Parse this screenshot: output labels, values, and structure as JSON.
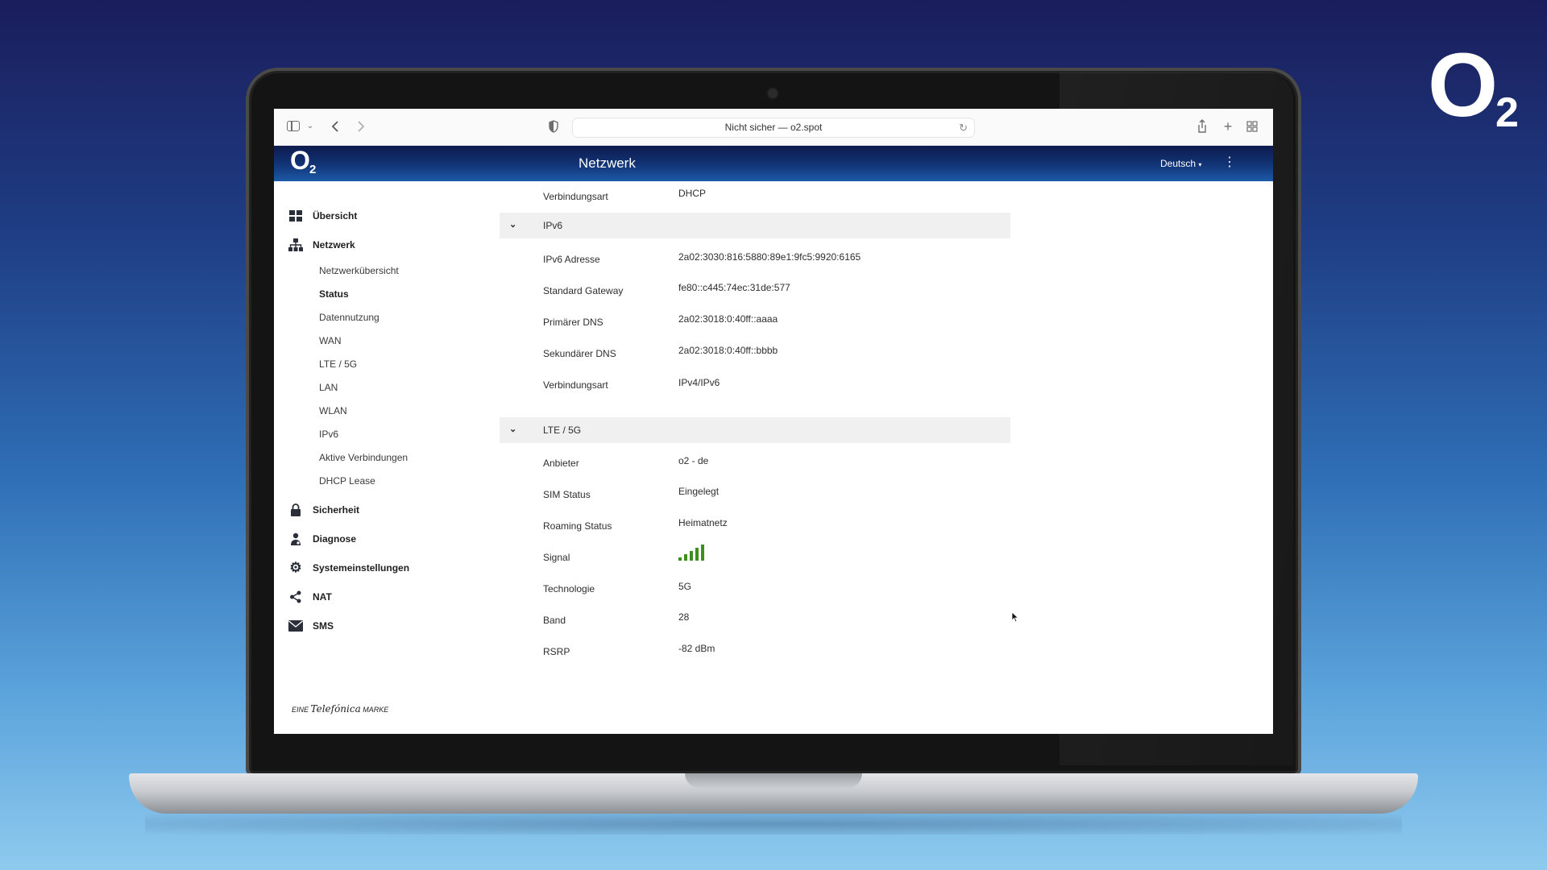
{
  "brand": {
    "letter": "O",
    "subscript": "2"
  },
  "browser": {
    "url_text": "Nicht sicher — o2.spot",
    "icons": [
      "sidebar-icon",
      "chevron-down-icon",
      "back-icon",
      "forward-icon",
      "shield-icon",
      "reload-icon",
      "share-icon",
      "plus-icon",
      "tab-overview-icon"
    ]
  },
  "header": {
    "logo_letter": "O",
    "logo_sub": "2",
    "title": "Netzwerk",
    "language": "Deutsch"
  },
  "sidebar": {
    "items": [
      {
        "label": "Übersicht",
        "icon": "dashboard-icon"
      },
      {
        "label": "Netzwerk",
        "icon": "network-icon"
      },
      {
        "label": "Sicherheit",
        "icon": "lock-icon"
      },
      {
        "label": "Diagnose",
        "icon": "diagnose-icon"
      },
      {
        "label": "Systemeinstellungen",
        "icon": "gear-icon"
      },
      {
        "label": "NAT",
        "icon": "share-icon"
      },
      {
        "label": "SMS",
        "icon": "envelope-icon"
      }
    ],
    "sub_items": [
      "Netzwerkübersicht",
      "Status",
      "Datennutzung",
      "WAN",
      "LTE / 5G",
      "LAN",
      "WLAN",
      "IPv6",
      "Aktive Verbindungen",
      "DHCP Lease"
    ],
    "active_sub": "Status",
    "footer": {
      "pre": "EINE",
      "brand": "Telefónica",
      "post": "MARKE"
    }
  },
  "content": {
    "top_row": {
      "label": "Verbindungsart",
      "value": "DHCP"
    },
    "ipv6": {
      "title": "IPv6",
      "rows": [
        {
          "label": "IPv6 Adresse",
          "value": "2a02:3030:816:5880:89e1:9fc5:9920:6165"
        },
        {
          "label": "Standard Gateway",
          "value": "fe80::c445:74ec:31de:577"
        },
        {
          "label": "Primärer DNS",
          "value": "2a02:3018:0:40ff::aaaa"
        },
        {
          "label": "Sekundärer DNS",
          "value": "2a02:3018:0:40ff::bbbb"
        },
        {
          "label": "Verbindungsart",
          "value": "IPv4/IPv6"
        }
      ]
    },
    "lte": {
      "title": "LTE / 5G",
      "rows": [
        {
          "label": "Anbieter",
          "value": "o2 - de"
        },
        {
          "label": "SIM Status",
          "value": "Eingelegt"
        },
        {
          "label": "Roaming Status",
          "value": "Heimatnetz"
        },
        {
          "label": "Signal",
          "value": ""
        },
        {
          "label": "Technologie",
          "value": "5G"
        },
        {
          "label": "Band",
          "value": "28"
        },
        {
          "label": "RSRP",
          "value": "-82 dBm"
        }
      ],
      "signal_bars": 5,
      "signal_color": "#3f8f1f"
    }
  }
}
